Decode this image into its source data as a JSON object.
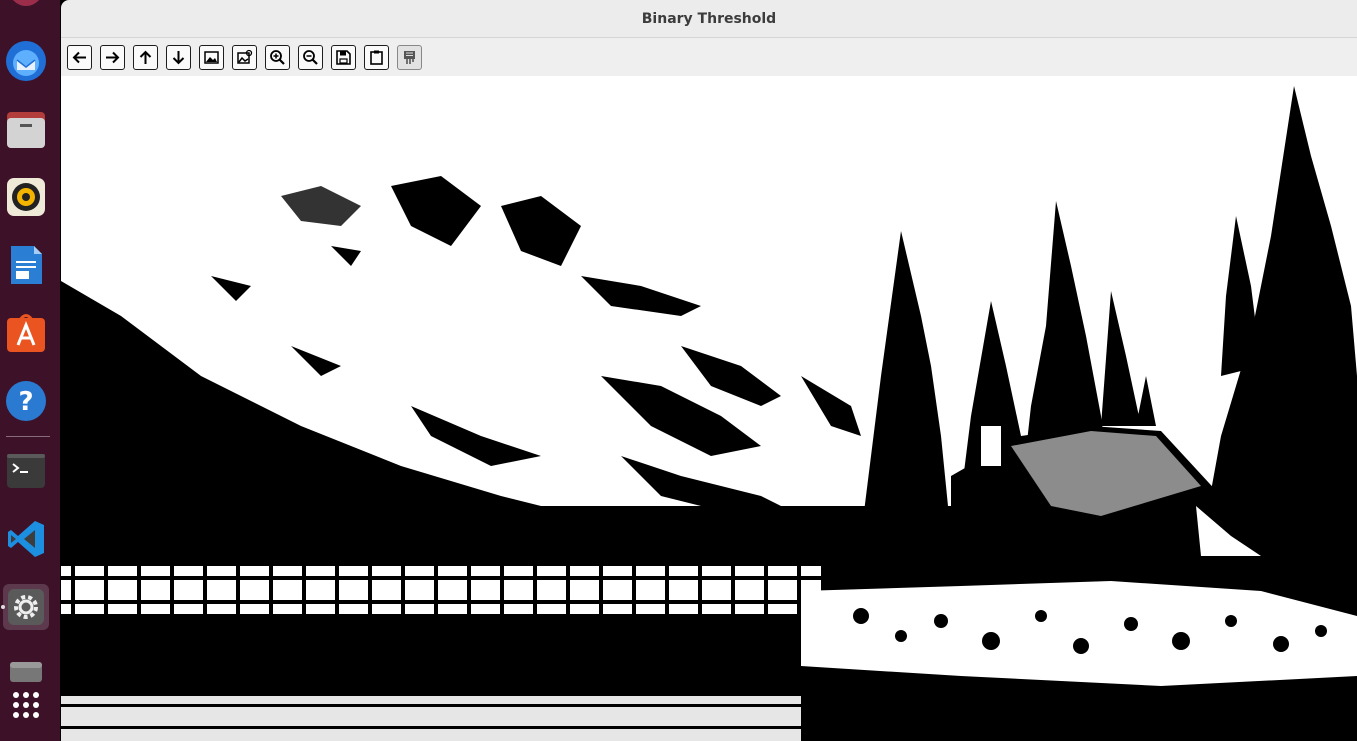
{
  "window": {
    "title": "Binary Threshold"
  },
  "dock": {
    "items": [
      {
        "name": "thunderbird"
      },
      {
        "name": "files"
      },
      {
        "name": "rhythmbox"
      },
      {
        "name": "libreoffice-writer"
      },
      {
        "name": "app-center"
      },
      {
        "name": "help"
      },
      {
        "name": "terminal"
      },
      {
        "name": "vscode"
      },
      {
        "name": "settings",
        "active": true
      },
      {
        "name": "disk"
      },
      {
        "name": "show-apps"
      }
    ]
  },
  "toolbar": {
    "buttons": [
      {
        "name": "back-icon"
      },
      {
        "name": "forward-icon"
      },
      {
        "name": "up-icon"
      },
      {
        "name": "down-icon"
      },
      {
        "name": "image-icon"
      },
      {
        "name": "image-settings-icon"
      },
      {
        "name": "zoom-in-icon"
      },
      {
        "name": "zoom-out-icon"
      },
      {
        "name": "save-icon"
      },
      {
        "name": "clipboard-icon"
      },
      {
        "name": "edit-icon",
        "disabled": true
      }
    ]
  },
  "image": {
    "description_colors": {
      "foreground": "#ffffff",
      "background": "#000000"
    }
  }
}
